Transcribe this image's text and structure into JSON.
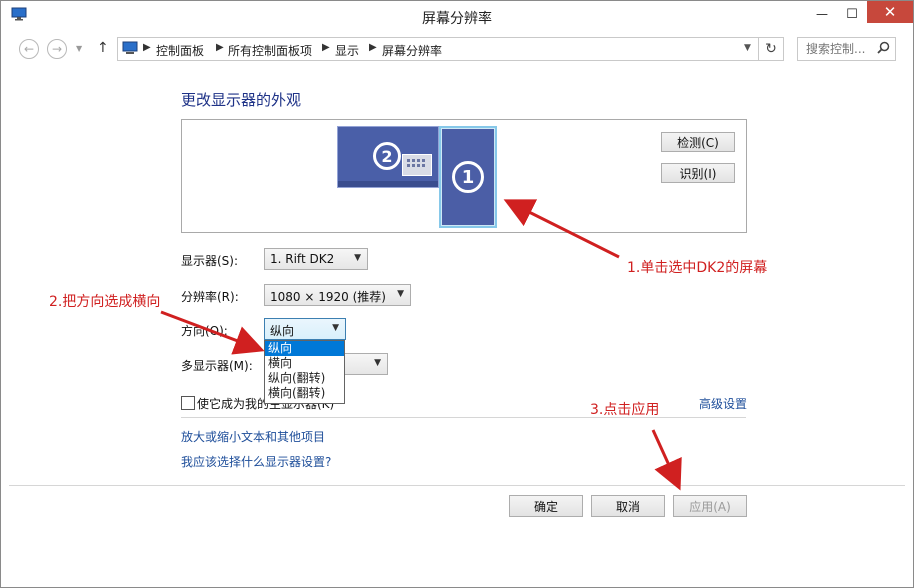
{
  "window": {
    "title": "屏幕分辨率",
    "minimize": "—",
    "maximize": "☐",
    "close": "✕"
  },
  "nav": {
    "back": "←",
    "forward": "→",
    "up": "↑",
    "breadcrumb": [
      "控制面板",
      "所有控制面板项",
      "显示",
      "屏幕分辨率"
    ],
    "refresh": "↻",
    "search_placeholder": "搜索控制..."
  },
  "main": {
    "heading": "更改显示器的外观",
    "monitor1_number": "1",
    "monitor2_number": "2",
    "detect_button": "检测(C)",
    "identify_button": "识别(I)",
    "display_label": "显示器(S):",
    "display_value": "1. Rift DK2",
    "resolution_label": "分辨率(R):",
    "resolution_value": "1080 × 1920 (推荐)",
    "orientation_label": "方向(O):",
    "orientation_value": "纵向",
    "orientation_options": [
      "纵向",
      "横向",
      "纵向(翻转)",
      "横向(翻转)"
    ],
    "multi_display_label": "多显示器(M):",
    "primary_checkbox_label": "使它成为我的主显示器(K)",
    "advanced_link": "高级设置",
    "link_text_size": "放大或缩小文本和其他项目",
    "link_which_settings": "我应该选择什么显示器设置?",
    "ok_button": "确定",
    "cancel_button": "取消",
    "apply_button": "应用(A)"
  },
  "annotations": {
    "step1": "1.单击选中DK2的屏幕",
    "step2": "2.把方向选成横向",
    "step3": "3.点击应用",
    "color": "#d02020"
  }
}
